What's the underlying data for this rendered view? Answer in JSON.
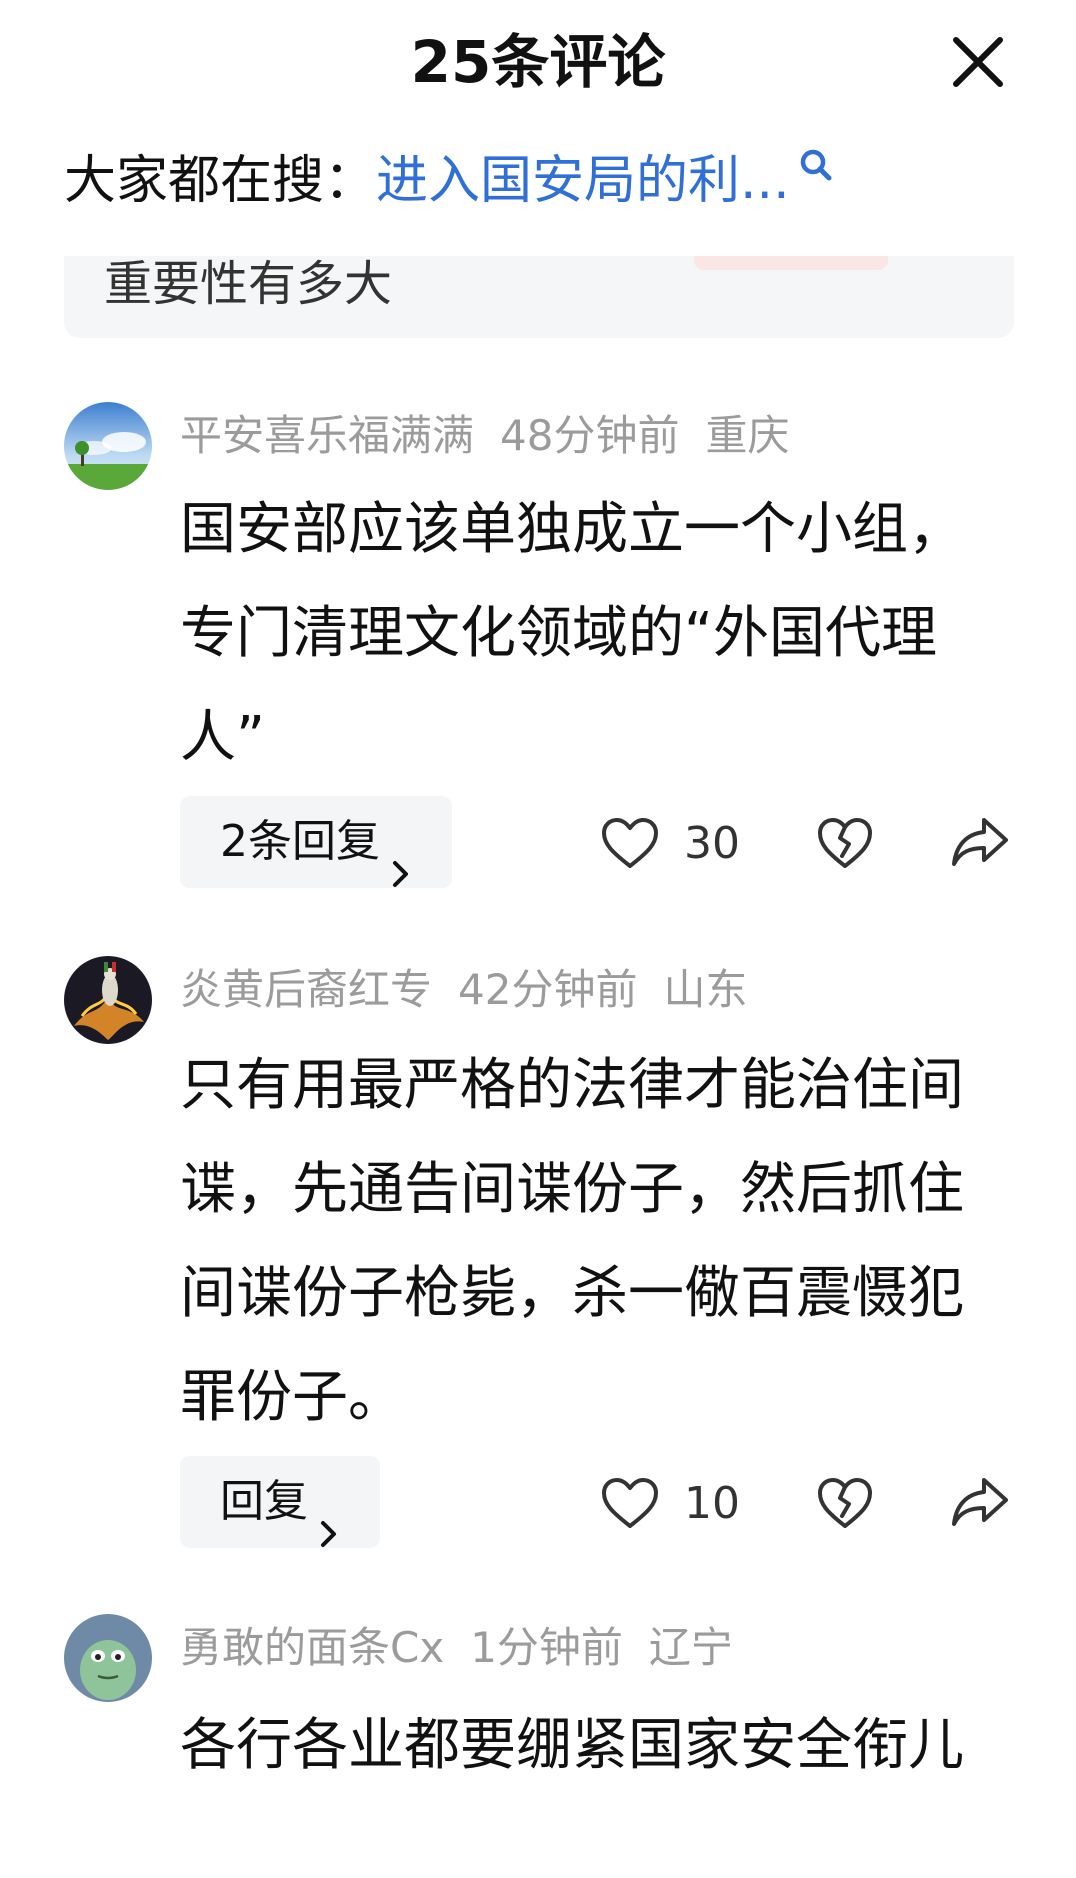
{
  "header": {
    "title": "25条评论"
  },
  "search": {
    "label": "大家都在搜：",
    "query": "进入国安局的利..."
  },
  "related": {
    "text": "重要性有多大"
  },
  "comments": [
    {
      "username": "平安喜乐福满满",
      "time": "48分钟前",
      "location": "重庆",
      "text": "国安部应该单独成立一个小组，专门清理文化领域的“外国代理人”",
      "reply_label": "2条回复",
      "likes": "30"
    },
    {
      "username": "炎黄后裔红专",
      "time": "42分钟前",
      "location": "山东",
      "text": "只有用最严格的法律才能治住间谍，先通告间谍份子，然后抓住间谍份子枪毙，杀一儆百震慑犯罪份子。",
      "reply_label": "回复",
      "likes": "10"
    },
    {
      "username": "勇敢的面条Cx",
      "time": "1分钟前",
      "location": "辽宁",
      "text": "各行各业都要绷紧国家安全衔儿"
    }
  ],
  "colors": {
    "link": "#2f6fd6",
    "meta": "#9b9b9b",
    "reply_bg": "#f4f5f6"
  }
}
